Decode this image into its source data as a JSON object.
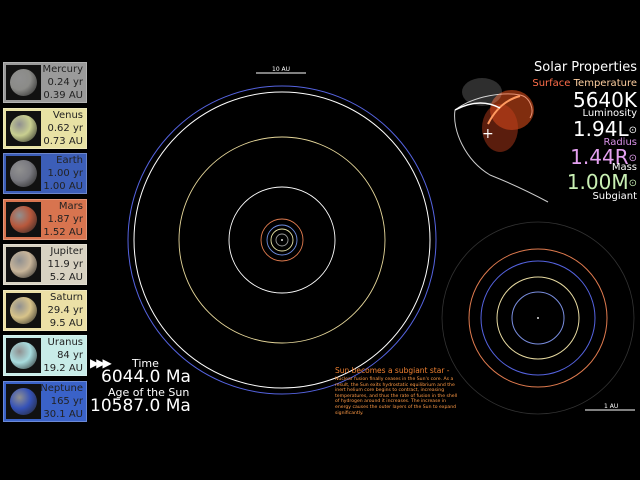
{
  "planets": [
    {
      "name": "Mercury",
      "period": "0.24 yr",
      "distance": "0.39 AU",
      "card_color": "#9a9a9a",
      "ball_color": "#8b8b88"
    },
    {
      "name": "Venus",
      "period": "0.62 yr",
      "distance": "0.73 AU",
      "card_color": "#e8e2a4",
      "ball_color": "#c9cf90"
    },
    {
      "name": "Earth",
      "period": "1.00 yr",
      "distance": "1.00 AU",
      "card_color": "#3c5eb8",
      "ball_color": "#7a7a80"
    },
    {
      "name": "Mars",
      "period": "1.87 yr",
      "distance": "1.52 AU",
      "card_color": "#d8744f",
      "ball_color": "#b8583c"
    },
    {
      "name": "Jupiter",
      "period": "11.9 yr",
      "distance": "5.2 AU",
      "card_color": "#d8d2c2",
      "ball_color": "#c8b59a"
    },
    {
      "name": "Saturn",
      "period": "29.4 yr",
      "distance": "9.5 AU",
      "card_color": "#ece0a6",
      "ball_color": "#d8c48a"
    },
    {
      "name": "Uranus",
      "period": "84 yr",
      "distance": "19.2 AU",
      "card_color": "#c8ece8",
      "ball_color": "#a8dcde"
    },
    {
      "name": "Neptune",
      "period": "165 yr",
      "distance": "30.1 AU",
      "card_color": "#3a62c8",
      "ball_color": "#3552b8"
    }
  ],
  "time": {
    "play_icon": "▶▶▶",
    "label": "Time",
    "value": "6044.0 Ma",
    "age_label": "Age of the Sun",
    "age_value": "10587.0 Ma"
  },
  "main_view": {
    "scale_label": "10 AU",
    "orbit_colors": [
      "#9b9b9b",
      "#e6e2a6",
      "#6e8ee0",
      "#e07b4f",
      "#ffffff",
      "#e6d79a",
      "#ffffff",
      "#5563e0"
    ]
  },
  "inset_view": {
    "scale_label": "1 AU",
    "orbit_colors": [
      "#7a8ee0",
      "#e6d9a0",
      "#5563e0",
      "#e07b4f"
    ]
  },
  "event": {
    "title": "Sun becomes a subgiant star -",
    "body": "Nuclear fusion finally ceases in the Sun's core. As a result, the Sun exits hydrostatic equilibrium and the inert helium core begins to contract, increasing temperatures, and thus the rate of fusion in the shell of hydrogen around it increases. The increase in energy causes the outer layers of the Sun to expand significantly."
  },
  "solar_properties": {
    "title": "Solar Properties",
    "temp_label_a": "Surface",
    "temp_label_b": " Temperature",
    "temp_value": "5640K",
    "lum_label": "Luminosity",
    "lum_value": "1.94L",
    "radius_label": "Radius",
    "radius_value": "1.44R",
    "mass_label": "Mass",
    "mass_value": "1.00M",
    "classification": "Subgiant",
    "sun_symbol": "⊙"
  },
  "colors": {
    "temp_label_a": "#ff6e4a",
    "temp_label_b": "#ffcfa0"
  }
}
